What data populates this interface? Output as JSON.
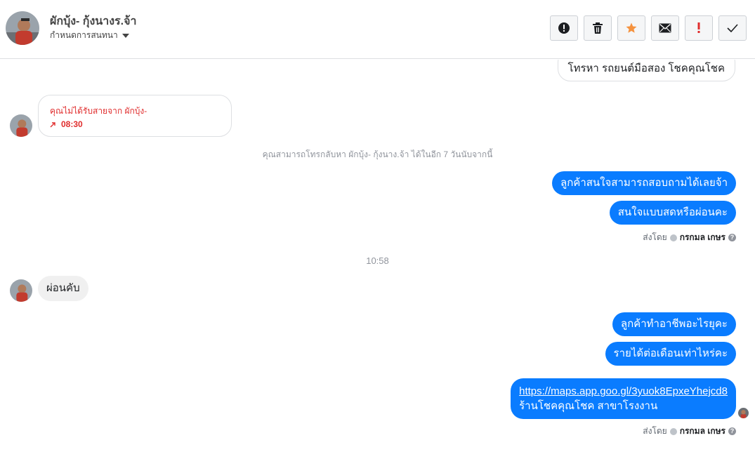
{
  "header": {
    "name": "ผักบุ้ง- กุ้งนางร.จ้า",
    "subtitle": "กำหนดการสนทนา",
    "actions": [
      "alert-icon",
      "trash-icon",
      "star-icon",
      "mail-icon",
      "important-icon",
      "check-icon"
    ],
    "colors": {
      "star": "#f5923e",
      "important": "#e02d2d"
    }
  },
  "messages": {
    "top_partial": "โทรหา รถยนต์มือสอง โชคคุณโชค",
    "missed_call_text": "คุณไม่ได้รับสายจาก ผักบุ้ง-",
    "missed_call_time": "08:30",
    "callback_note": "คุณสามารถโทรกลับหา ผักบุ้ง- กุ้งนาง.จ้า ได้ในอีก 7 วันนับจากนี้",
    "out_1": "ลูกค้าสนใจสามารถสอบถามได้เลยจ้า",
    "out_2": "สนใจแบบสดหรือผ่อนคะ",
    "sent_by_label": "ส่งโดย",
    "sent_by_name": "กรกมล เกษร",
    "help": "?",
    "time_divider": "10:58",
    "in_1": "ผ่อนคับ",
    "out_3": "ลูกค้าทำอาชีพอะไรยุคะ",
    "out_4": "รายได้ต่อเดือนเท่าไหร่คะ",
    "out_5_link": "https://maps.app.goo.gl/3yuok8EpxeYhejcd8",
    "out_5_text": "ร้านโชคคุณโชค สาขาโรงงาน",
    "accent": "#0a7cff"
  }
}
